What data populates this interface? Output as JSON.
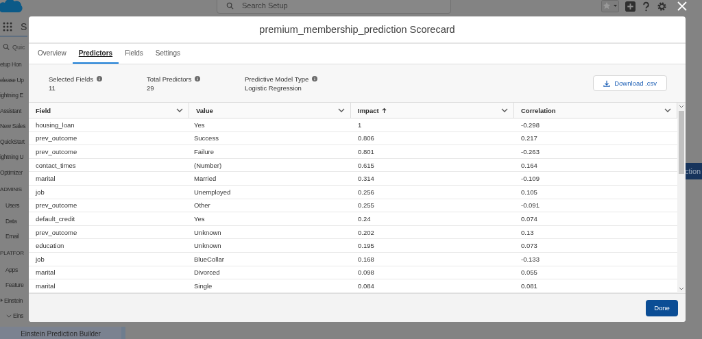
{
  "background": {
    "search": {
      "placeholder": "Search Setup"
    },
    "app_name": "S",
    "quick_find": {
      "placeholder": "Quic"
    },
    "sidebar": [
      {
        "kind": "item",
        "label": "etup Hon"
      },
      {
        "kind": "item",
        "label": "elease Up"
      },
      {
        "kind": "item",
        "label": "ightning E"
      },
      {
        "kind": "item",
        "label": "Assistant"
      },
      {
        "kind": "item",
        "label": "New Sales"
      },
      {
        "kind": "item",
        "label": "QuickStart"
      },
      {
        "kind": "item",
        "label": "ightning U"
      },
      {
        "kind": "item",
        "label": "Optimizer"
      },
      {
        "kind": "section",
        "label": "ADMINIS"
      },
      {
        "kind": "sub",
        "label": "Users"
      },
      {
        "kind": "sub",
        "label": "Data"
      },
      {
        "kind": "sub",
        "label": "Email"
      },
      {
        "kind": "section",
        "label": "PLATFOR"
      },
      {
        "kind": "sub",
        "label": "Apps"
      },
      {
        "kind": "sub",
        "label": "Feature"
      },
      {
        "kind": "group",
        "label": "Einstein"
      },
      {
        "kind": "subgroup",
        "label": "Eins"
      }
    ],
    "selected_item": {
      "label": "Einstein Prediction Builder",
      "selected": true
    },
    "side_button": "ction"
  },
  "modal": {
    "title": "premium_membership_prediction Scorecard",
    "tabs": [
      {
        "label": "Overview",
        "selected": false
      },
      {
        "label": "Predictors",
        "selected": true
      },
      {
        "label": "Fields",
        "selected": false
      },
      {
        "label": "Settings",
        "selected": false
      }
    ],
    "stats": [
      {
        "label": "Selected Fields",
        "value": "11"
      },
      {
        "label": "Total Predictors",
        "value": "29"
      },
      {
        "label": "Predictive Model Type",
        "value": "Logistic Regression"
      }
    ],
    "download_button": "Download .csv",
    "table": {
      "columns": [
        {
          "label": "Field",
          "sorted": false
        },
        {
          "label": "Value",
          "sorted": false
        },
        {
          "label": "Impact",
          "sorted": true
        },
        {
          "label": "Correlation",
          "sorted": false
        }
      ],
      "rows": [
        [
          "housing_loan",
          "Yes",
          "1",
          "-0.298"
        ],
        [
          "prev_outcome",
          "Success",
          "0.806",
          "0.217"
        ],
        [
          "prev_outcome",
          "Failure",
          "0.801",
          "-0.263"
        ],
        [
          "contact_times",
          "(Number)",
          "0.615",
          "0.164"
        ],
        [
          "marital",
          "Married",
          "0.314",
          "-0.109"
        ],
        [
          "job",
          "Unemployed",
          "0.256",
          "0.105"
        ],
        [
          "prev_outcome",
          "Other",
          "0.255",
          "-0.091"
        ],
        [
          "default_credit",
          "Yes",
          "0.24",
          "0.074"
        ],
        [
          "prev_outcome",
          "Unknown",
          "0.202",
          "0.13"
        ],
        [
          "education",
          "Unknown",
          "0.195",
          "0.073"
        ],
        [
          "job",
          "BlueCollar",
          "0.168",
          "-0.133"
        ],
        [
          "marital",
          "Divorced",
          "0.098",
          "0.055"
        ],
        [
          "marital",
          "Single",
          "0.084",
          "0.081"
        ]
      ]
    },
    "done_button": "Done"
  }
}
